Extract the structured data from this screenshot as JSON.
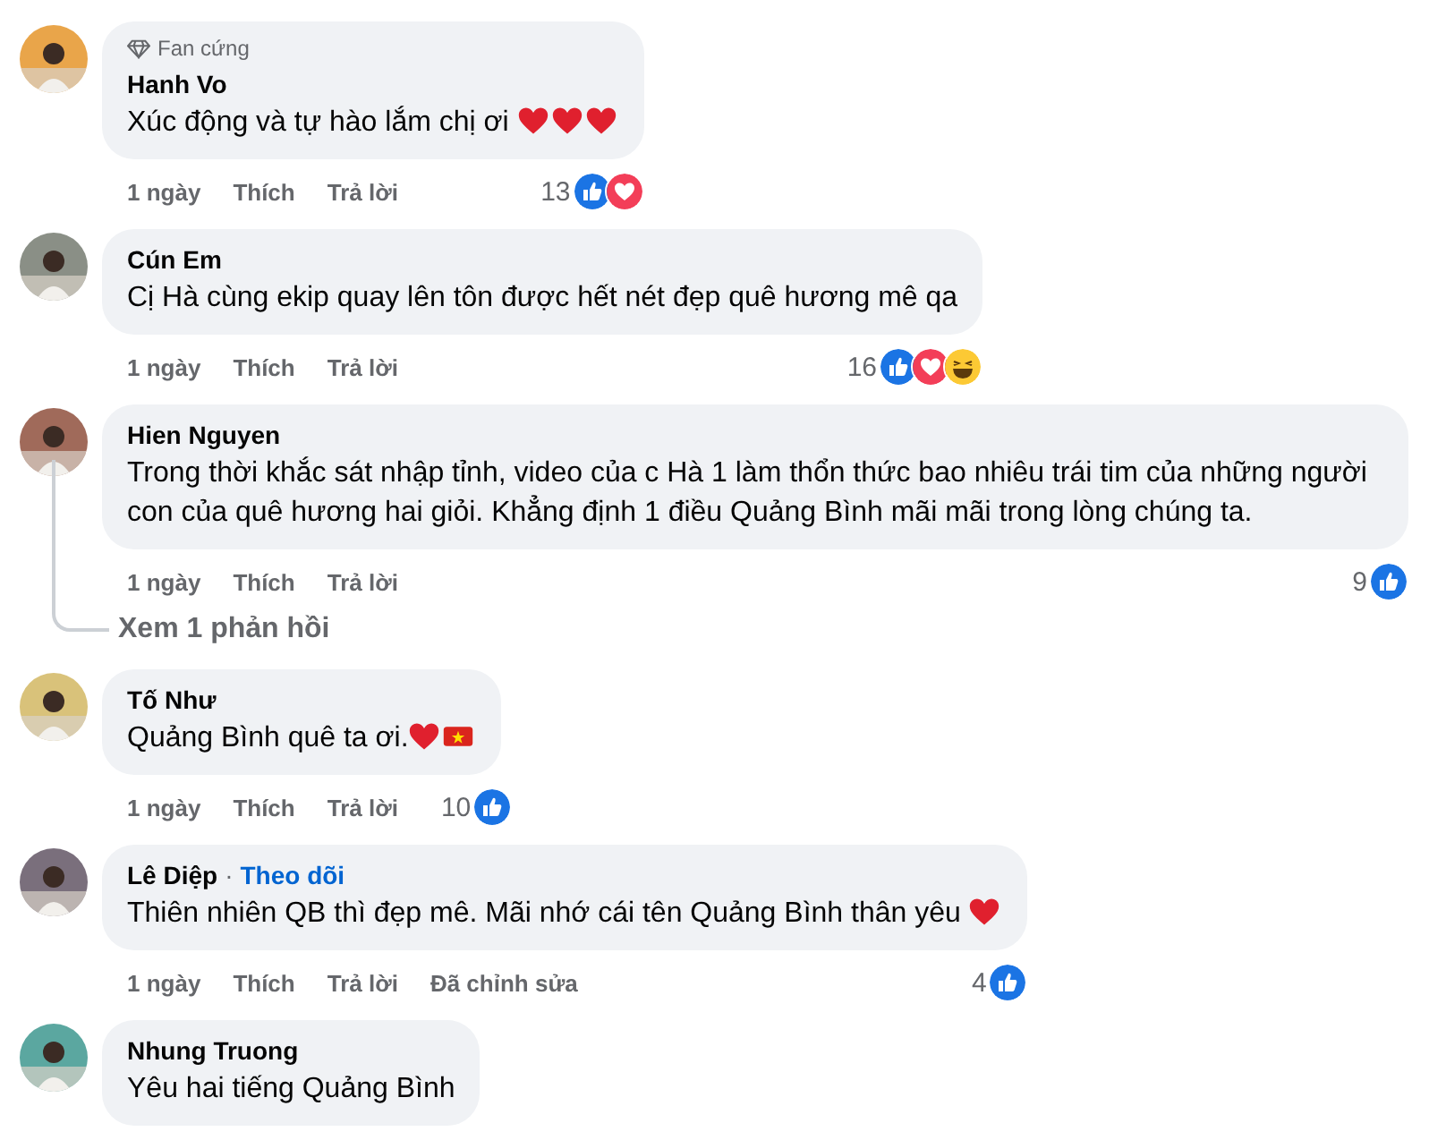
{
  "comments": [
    {
      "author": "Hanh Vo",
      "badge": "Fan cứng",
      "text": "Xúc động và tự hào lắm chị ơi ",
      "emojis": [
        {
          "kind": "heart"
        },
        {
          "kind": "heart"
        },
        {
          "kind": "heart"
        }
      ],
      "time": "1 ngày",
      "like": "Thích",
      "reply": "Trả lời",
      "reaction_count": "13",
      "reactions": [
        {
          "kind": "like"
        },
        {
          "kind": "love"
        }
      ]
    },
    {
      "author": "Cún Em",
      "text": "Cị Hà cùng ekip quay lên tôn được hết nét đẹp quê hương mê qa",
      "time": "1 ngày",
      "like": "Thích",
      "reply": "Trả lời",
      "reaction_count": "16",
      "reactions": [
        {
          "kind": "like"
        },
        {
          "kind": "love"
        },
        {
          "kind": "haha"
        }
      ]
    },
    {
      "author": "Hien Nguyen",
      "text": "Trong thời khắc sát nhập tỉnh, video của c Hà 1 làm thổn thức bao nhiêu trái tim của những người con của quê hương hai giỏi. Khẳng định 1 điều Quảng Bình mãi mãi trong lòng chúng ta.",
      "time": "1 ngày",
      "like": "Thích",
      "reply": "Trả lời",
      "reaction_count": "9",
      "reactions": [
        {
          "kind": "like"
        }
      ],
      "replies_link": "Xem 1 phản hồi"
    },
    {
      "author": "Tố Như",
      "text": "Quảng Bình quê ta ơi.",
      "emojis": [
        {
          "kind": "heart"
        },
        {
          "kind": "flag"
        }
      ],
      "time": "1 ngày",
      "like": "Thích",
      "reply": "Trả lời",
      "reaction_count": "10",
      "reactions": [
        {
          "kind": "like"
        }
      ]
    },
    {
      "author": "Lê Diệp",
      "separator": "·",
      "follow": "Theo dõi",
      "text": "Thiên nhiên QB thì đẹp mê. Mãi nhớ cái tên Quảng Bình thân yêu ",
      "emojis": [
        {
          "kind": "heart"
        }
      ],
      "time": "1 ngày",
      "like": "Thích",
      "reply": "Trả lời",
      "edited": "Đã chỉnh sửa",
      "reaction_count": "4",
      "reactions": [
        {
          "kind": "like"
        }
      ]
    },
    {
      "author": "Nhung Truong",
      "text": "Yêu hai tiếng Quảng Bình"
    }
  ]
}
